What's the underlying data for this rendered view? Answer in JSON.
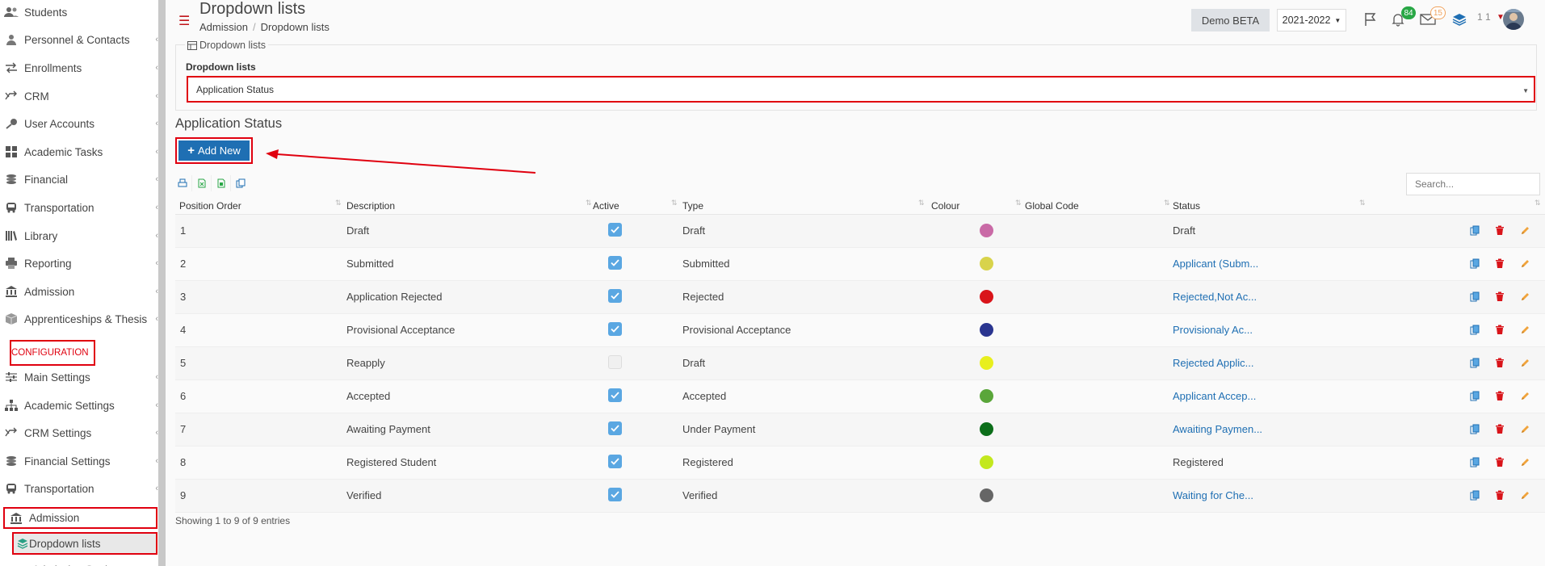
{
  "sidebar": {
    "items": [
      {
        "label": "Students",
        "icon": "users-icon",
        "chevron": false
      },
      {
        "label": "Personnel & Contacts",
        "icon": "user-icon",
        "chevron": true
      },
      {
        "label": "Enrollments",
        "icon": "exchange-icon",
        "chevron": true
      },
      {
        "label": "CRM",
        "icon": "shuffle-icon",
        "chevron": true
      },
      {
        "label": "User Accounts",
        "icon": "key-icon",
        "chevron": true
      },
      {
        "label": "Academic Tasks",
        "icon": "grid-icon",
        "chevron": true
      },
      {
        "label": "Financial",
        "icon": "coins-icon",
        "chevron": true
      },
      {
        "label": "Transportation",
        "icon": "bus-icon",
        "chevron": true
      },
      {
        "label": "Library",
        "icon": "books-icon",
        "chevron": true
      },
      {
        "label": "Reporting",
        "icon": "printer-icon",
        "chevron": true
      },
      {
        "label": "Admission",
        "icon": "bank-icon",
        "chevron": true
      },
      {
        "label": "Apprenticeships & Thesis",
        "icon": "box-icon",
        "chevron": true
      }
    ],
    "section_label": "CONFIGURATION",
    "config_items": [
      {
        "label": "Main Settings",
        "icon": "sliders-icon",
        "chevron": true
      },
      {
        "label": "Academic Settings",
        "icon": "sitemap-icon",
        "chevron": true
      },
      {
        "label": "CRM Settings",
        "icon": "shuffle-icon",
        "chevron": true
      },
      {
        "label": "Financial Settings",
        "icon": "coins-icon",
        "chevron": true
      },
      {
        "label": "Transportation",
        "icon": "bus-icon",
        "chevron": true
      }
    ],
    "active_parent": {
      "label": "Admission",
      "icon": "bank-icon"
    },
    "active_child": {
      "label": "Dropdown lists",
      "icon": "layers-icon"
    },
    "partial_next": {
      "label": "Admission Settings"
    }
  },
  "header": {
    "title": "Dropdown lists",
    "breadcrumb": [
      "Admission",
      "Dropdown lists"
    ],
    "demo_label": "Demo BETA",
    "year": "2021-2022",
    "notifications_count": "84",
    "messages_count": "15",
    "user_count": "1 1",
    "colors": {
      "notif_badge": "#28a745",
      "msg_badge": "#f0a35e",
      "accent": "#c0141a"
    }
  },
  "filter": {
    "legend": "Dropdown lists",
    "label": "Dropdown lists",
    "selected": "Application Status"
  },
  "section_title": "Application Status",
  "add_new_label": "Add New",
  "search_placeholder": "Search...",
  "table": {
    "columns": [
      "Position Order",
      "Description",
      "Active",
      "Type",
      "Colour",
      "Global Code",
      "Status"
    ],
    "rows": [
      {
        "order": "1",
        "description": "Draft",
        "active": true,
        "type": "Draft",
        "colour": "#c96aa6",
        "global_code": "",
        "status": "Draft",
        "status_link": false
      },
      {
        "order": "2",
        "description": "Submitted",
        "active": true,
        "type": "Submitted",
        "colour": "#d8d34b",
        "global_code": "",
        "status": "Applicant (Subm...",
        "status_link": true
      },
      {
        "order": "3",
        "description": "Application Rejected",
        "active": true,
        "type": "Rejected",
        "colour": "#d9141a",
        "global_code": "",
        "status": "Rejected,Not Ac...",
        "status_link": true
      },
      {
        "order": "4",
        "description": "Provisional Acceptance",
        "active": true,
        "type": "Provisional Acceptance",
        "colour": "#2a3590",
        "global_code": "",
        "status": "Provisionaly Ac...",
        "status_link": true
      },
      {
        "order": "5",
        "description": "Reapply",
        "active": false,
        "type": "Draft",
        "colour": "#e8ef1e",
        "global_code": "",
        "status": "Rejected Applic...",
        "status_link": true
      },
      {
        "order": "6",
        "description": "Accepted",
        "active": true,
        "type": "Accepted",
        "colour": "#5aa63a",
        "global_code": "",
        "status": "Applicant Accep...",
        "status_link": true
      },
      {
        "order": "7",
        "description": "Awaiting Payment",
        "active": true,
        "type": "Under Payment",
        "colour": "#0c6e1a",
        "global_code": "",
        "status": "Awaiting Paymen...",
        "status_link": true
      },
      {
        "order": "8",
        "description": "Registered Student",
        "active": true,
        "type": "Registered",
        "colour": "#c3e81e",
        "global_code": "",
        "status": "Registered",
        "status_link": false
      },
      {
        "order": "9",
        "description": "Verified",
        "active": true,
        "type": "Verified",
        "colour": "#666666",
        "global_code": "",
        "status": "Waiting for Che...",
        "status_link": true
      }
    ]
  },
  "footer_info": "Showing 1 to 9 of 9 entries"
}
